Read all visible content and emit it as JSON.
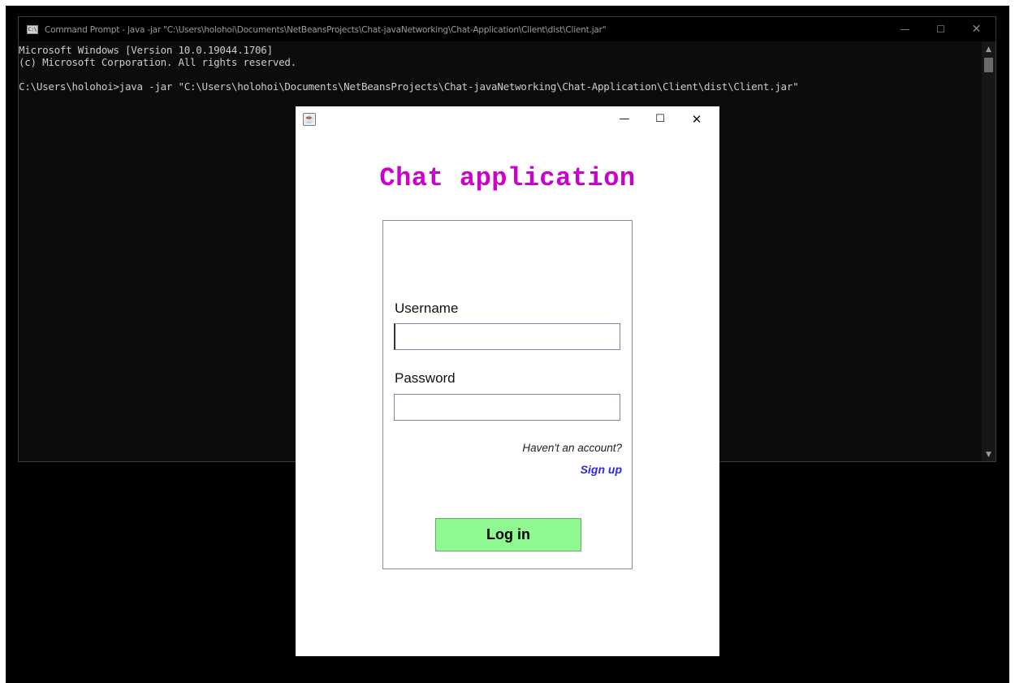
{
  "cmd": {
    "title": "Command Prompt - java  -jar \"C:\\Users\\holohoi\\Documents\\NetBeansProjects\\Chat-javaNetworking\\Chat-Application\\Client\\dist\\Client.jar\"",
    "icon": "C:\\",
    "controls": {
      "minimize": "—",
      "maximize": "☐",
      "close": "✕"
    },
    "lines": [
      "Microsoft Windows [Version 10.0.19044.1706]",
      "(c) Microsoft Corporation. All rights reserved.",
      "",
      "C:\\Users\\holohoi>java -jar \"C:\\Users\\holohoi\\Documents\\NetBeansProjects\\Chat-javaNetworking\\Chat-Application\\Client\\dist\\Client.jar\""
    ],
    "scroll_up": "▲",
    "scroll_down": "▼"
  },
  "login": {
    "window_icon": "☕",
    "controls": {
      "minimize": "—",
      "maximize": "☐",
      "close": "✕"
    },
    "heading": "Chat application",
    "username_label": "Username",
    "username_value": "",
    "password_label": "Password",
    "password_value": "",
    "no_account_text": "Haven't an account?",
    "signup_label": "Sign up",
    "login_button": "Log in"
  },
  "colors": {
    "heading": "#cc00cc",
    "signup_link": "#2a2ae8",
    "login_button_bg": "#8ff890",
    "console_bg": "#0c0c0c",
    "console_text": "#cccccc"
  }
}
